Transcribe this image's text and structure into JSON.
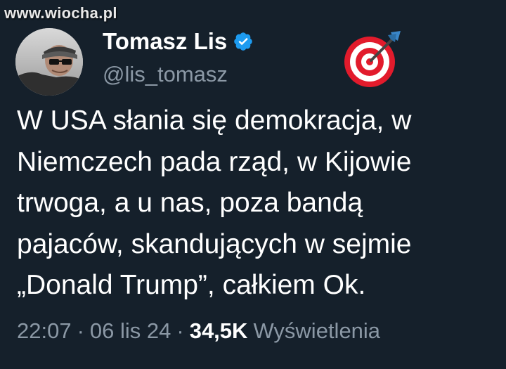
{
  "watermark": "www.wiocha.pl",
  "author": {
    "display_name": "Tomasz Lis",
    "handle": "@lis_tomasz",
    "verified": true
  },
  "header_emoji": "direct-hit-target-icon",
  "tweet": {
    "lines": [
      "W USA słania się demokracja, w",
      "Niemczech pada rząd, w Kijowie",
      "trwoga, a u nas, poza bandą",
      "pajaców, skandujących w sejmie",
      "„Donald Trump”, całkiem Ok."
    ]
  },
  "meta": {
    "time": "22:07",
    "separator": "·",
    "date": "06 lis 24",
    "views_count": "34,5K",
    "views_label": "Wyświetlenia"
  },
  "colors": {
    "background": "#15202b",
    "text": "#ffffff",
    "muted": "#8b98a5",
    "verified_blue": "#1d9bf0"
  }
}
